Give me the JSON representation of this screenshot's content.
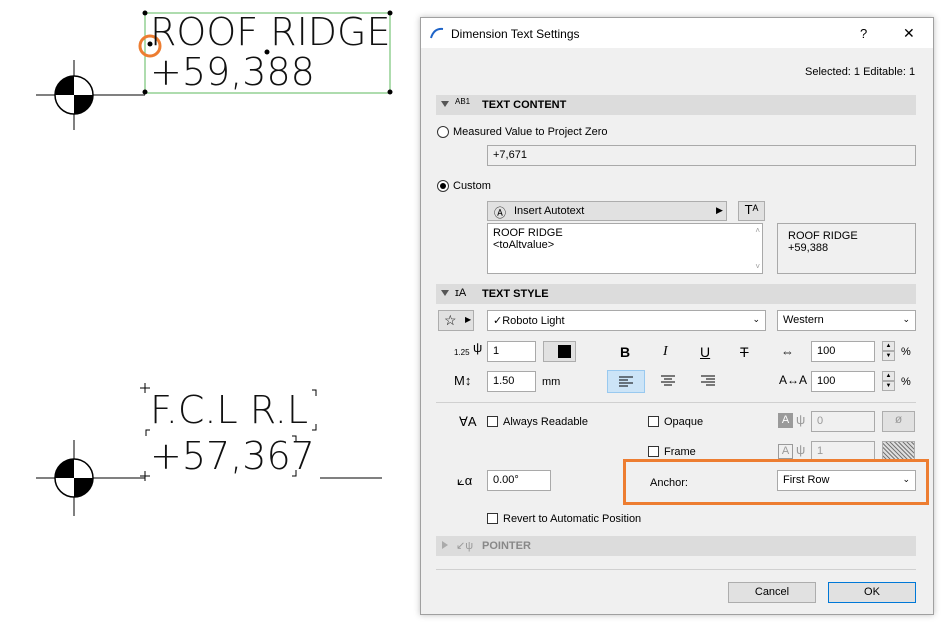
{
  "drawing": {
    "label1_line1": "ROOF RIDGE",
    "label1_line2": "+59,388",
    "label2_line1": "F.C.L R.L",
    "label2_line2": "+57,367"
  },
  "dialog": {
    "title": "Dimension Text Settings",
    "help_glyph": "?",
    "close_glyph": "✕",
    "selection_info": "Selected: 1 Editable: 1",
    "text_content": {
      "header": "TEXT CONTENT",
      "measured_label": "Measured Value to Project Zero",
      "measured_value": "+7,671",
      "custom_label": "Custom",
      "insert_autotext": "Insert Autotext",
      "custom_text_line1": "ROOF RIDGE",
      "custom_text_line2": "<toAltvalue>",
      "preview_line1": "ROOF RIDGE",
      "preview_line2": "+59,388"
    },
    "text_style": {
      "header": "TEXT STYLE",
      "font": "Roboto Light",
      "script": "Western",
      "pen_size_label": "1.25",
      "pen": "1",
      "height": "1.50",
      "height_unit": "mm",
      "width_factor": "100",
      "spacing_factor": "100",
      "percent1": "%",
      "percent2": "%",
      "bold_glyph": "B",
      "italic_glyph": "I",
      "underline_glyph": "U",
      "strike_glyph": "T"
    },
    "options": {
      "always_readable": "Always Readable",
      "opaque": "Opaque",
      "frame": "Frame",
      "opaque_value": "0",
      "frame_value": "1",
      "angle": "0.00°",
      "anchor_label": "Anchor:",
      "anchor_value": "First Row",
      "revert": "Revert to Automatic Position"
    },
    "pointer_header": "POINTER",
    "cancel": "Cancel",
    "ok": "OK"
  },
  "colors": {
    "highlight": "#ed7d31",
    "selection_box": "#4caf50",
    "selected_align": "#cce4f7"
  }
}
